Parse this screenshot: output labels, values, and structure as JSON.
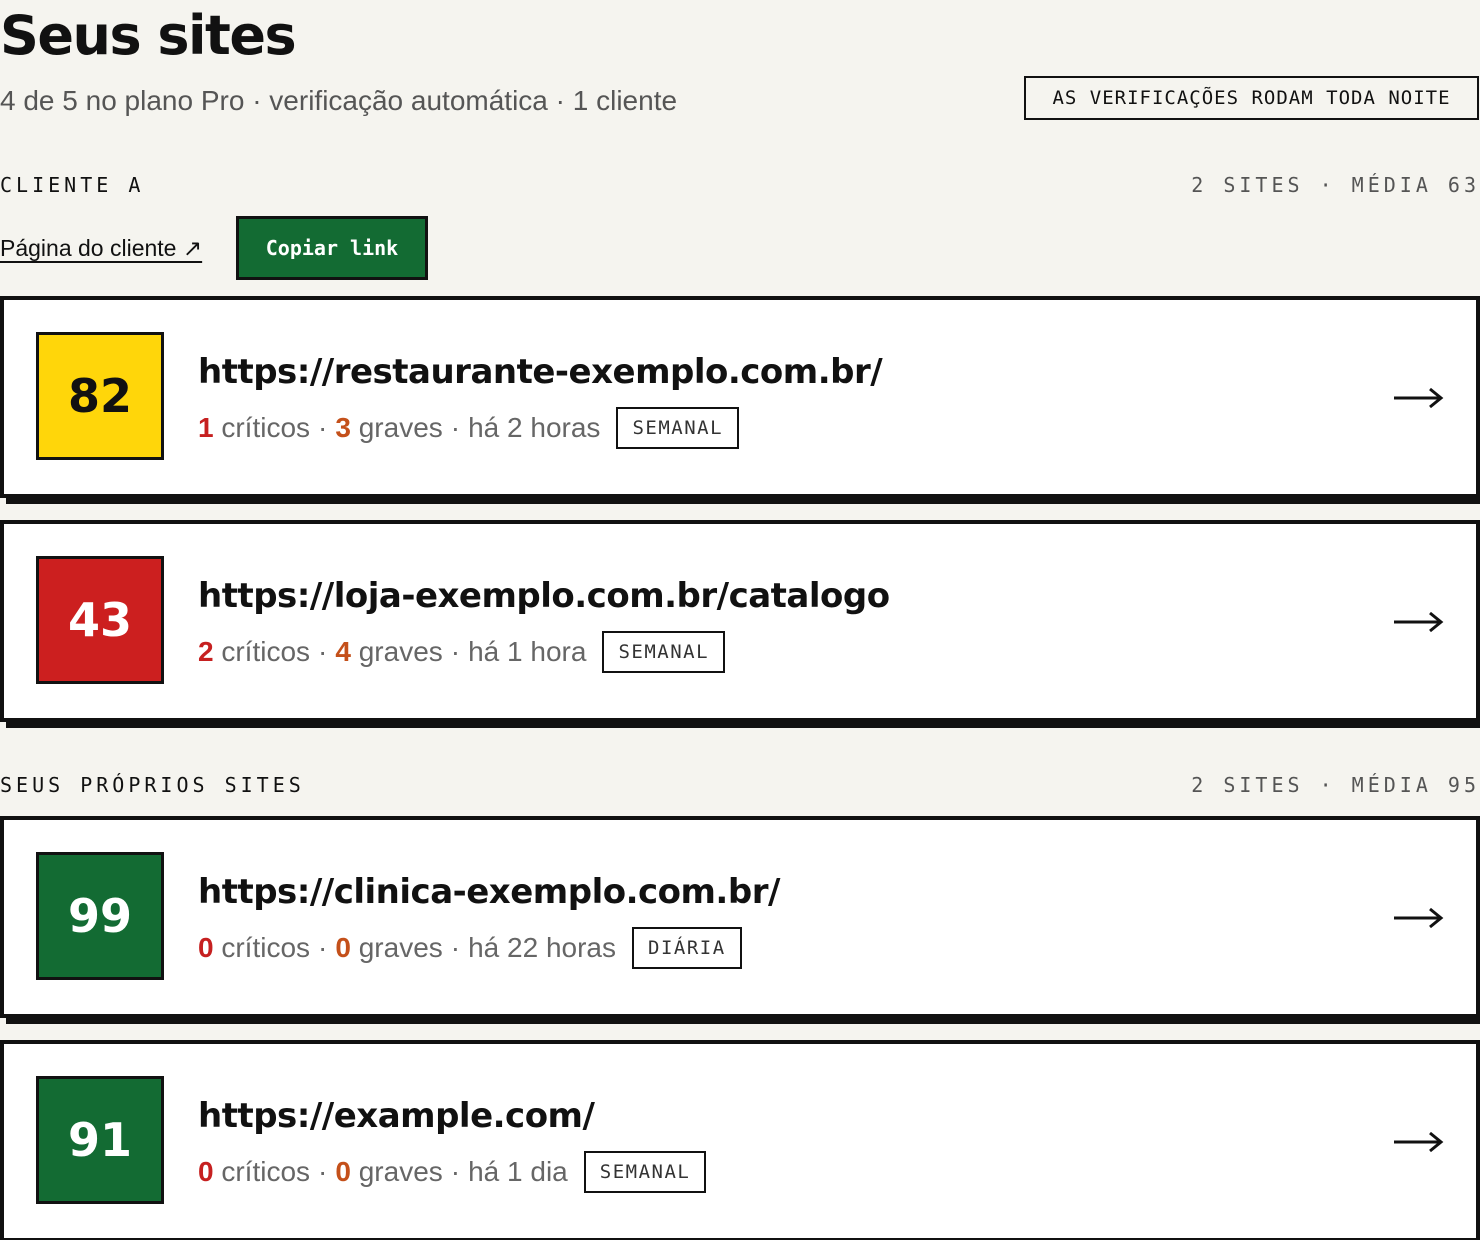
{
  "header": {
    "title": "Seus sites",
    "subtitle": "4 de 5 no plano Pro · verificação automática · 1 cliente",
    "nightly_badge": "AS VERIFICAÇÕES RODAM TODA NOITE"
  },
  "groups": [
    {
      "name": "CLIENTE A",
      "stats": "2 SITES · MÉDIA 63",
      "client_link": "Página do cliente ↗",
      "copy_button": "Copiar link",
      "sites": [
        {
          "score": "82",
          "score_color": "#ffd60a",
          "score_text_color": "#111111",
          "url": "https://restaurante-exemplo.com.br/",
          "critical_count": "1",
          "critical_label": "críticos",
          "grave_count": "3",
          "grave_label": "graves",
          "time": "há 2 horas",
          "frequency": "SEMANAL"
        },
        {
          "score": "43",
          "score_color": "#cc1f1f",
          "score_text_color": "#ffffff",
          "url": "https://loja-exemplo.com.br/catalogo",
          "critical_count": "2",
          "critical_label": "críticos",
          "grave_count": "4",
          "grave_label": "graves",
          "time": "há 1 hora",
          "frequency": "SEMANAL"
        }
      ]
    },
    {
      "name": "SEUS PRÓPRIOS SITES",
      "stats": "2 SITES · MÉDIA 95",
      "sites": [
        {
          "score": "99",
          "score_color": "#136b33",
          "score_text_color": "#ffffff",
          "url": "https://clinica-exemplo.com.br/",
          "critical_count": "0",
          "critical_label": "críticos",
          "grave_count": "0",
          "grave_label": "graves",
          "time": "há 22 horas",
          "frequency": "DIÁRIA"
        },
        {
          "score": "91",
          "score_color": "#136b33",
          "score_text_color": "#ffffff",
          "url": "https://example.com/",
          "critical_count": "0",
          "critical_label": "críticos",
          "grave_count": "0",
          "grave_label": "graves",
          "time": "há 1 dia",
          "frequency": "SEMANAL"
        }
      ]
    }
  ],
  "icons": {
    "open_site": "arrow-right-icon",
    "external_link": "external-link-icon"
  },
  "colors": {
    "background": "#f5f4ef",
    "accent_green": "#136b33",
    "critical": "#c62020",
    "grave": "#c4501a"
  }
}
